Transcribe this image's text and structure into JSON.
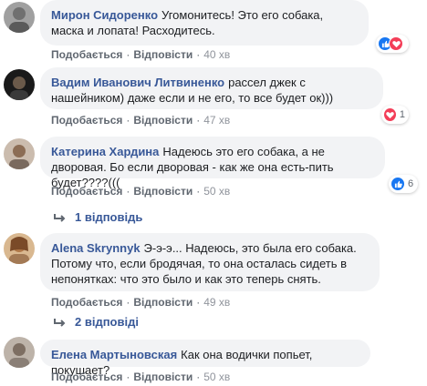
{
  "comments": [
    {
      "author": "Мирон Сидоренко",
      "text": "Угомонитесь! Это его собака, маска и лопата! Расходитесь.",
      "like_label": "Подобається",
      "reply_label": "Відповісти",
      "time": "40 хв",
      "reaction_count": "",
      "reactions": [
        "like-icon",
        "love-icon"
      ],
      "avatar_color": "#8d8d8d"
    },
    {
      "author": "Вадим Иванович Литвиненко",
      "text": "рассел джек с нашейником) даже если и не его, то все будет ок)))",
      "like_label": "Подобається",
      "reply_label": "Відповісти",
      "time": "47 хв",
      "reaction_count": "1",
      "reactions": [
        "love-icon"
      ],
      "avatar_color": "#2a2a2a"
    },
    {
      "author": "Катерина Хардина",
      "text": "Надеюсь это его собака, а не дворовая. Бо если дворовая - как же она есть-пить будет????(((",
      "like_label": "Подобається",
      "reply_label": "Відповісти",
      "time": "50 хв",
      "reaction_count": "6",
      "reactions": [
        "like-icon"
      ],
      "avatar_color": "#b8a89a",
      "replies_label": "1 відповідь"
    },
    {
      "author": "Alena Skrynnyk",
      "text": "Э-э-э... Надеюсь, это была его собака. Потому что, если бродячая, то она осталась сидеть в непонятках: что это было и как это теперь снять.",
      "like_label": "Подобається",
      "reply_label": "Відповісти",
      "time": "49 хв",
      "reaction_count": "",
      "reactions": [],
      "avatar_color": "#c59a6a",
      "replies_label": "2 відповіді"
    },
    {
      "author": "Елена Мартыновская",
      "text": "Как она водички попьет, покушает?",
      "like_label": "Подобається",
      "reply_label": "Відповісти",
      "time": "50 хв",
      "reaction_count": "",
      "reactions": [],
      "avatar_color": "#9a8f86"
    }
  ],
  "colors": {
    "link": "#385898",
    "bubble": "#f2f3f5",
    "meta": "#606770",
    "like": "#1877f2",
    "love": "#f33e58"
  }
}
